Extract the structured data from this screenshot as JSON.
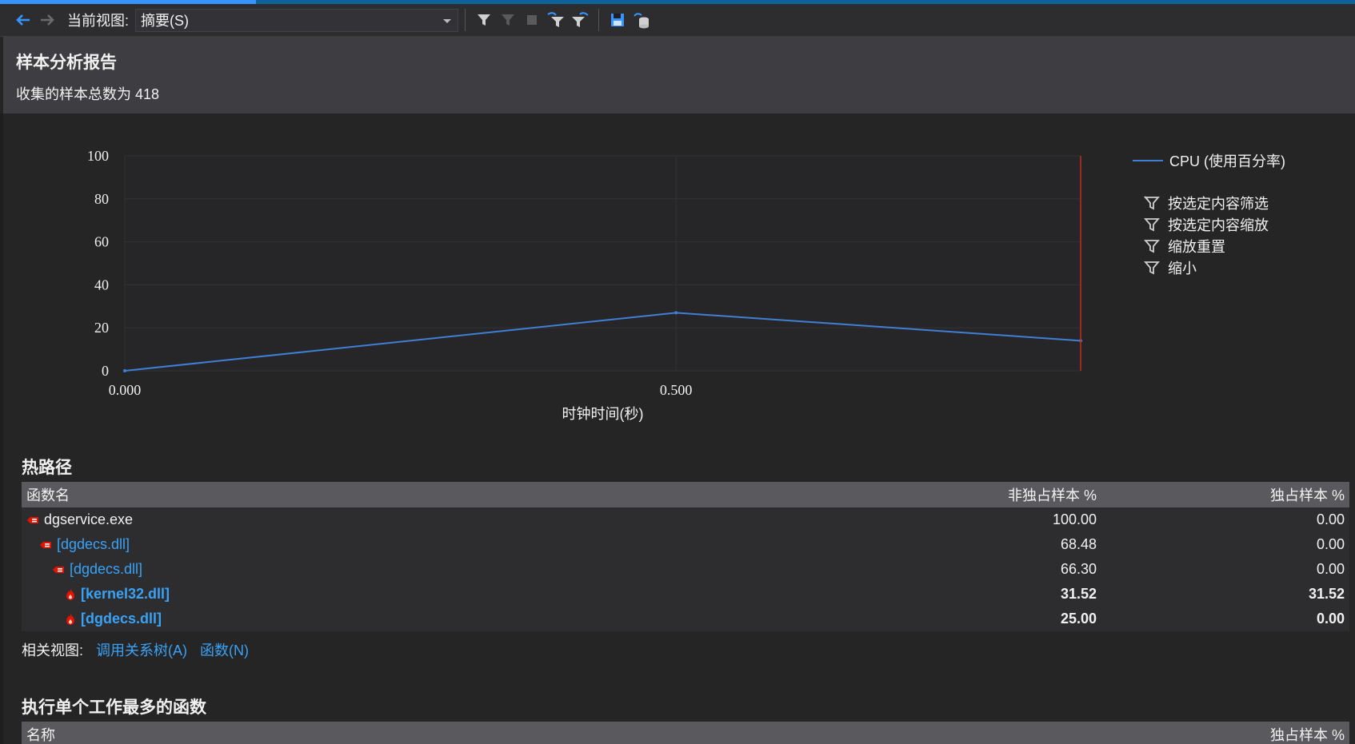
{
  "toolbar": {
    "view_label": "当前视图:",
    "view_value": "摘要(S)"
  },
  "header": {
    "title": "样本分析报告",
    "subtitle": "收集的样本总数为 418"
  },
  "chart_data": {
    "type": "line",
    "x": [
      0.0,
      0.5,
      0.867
    ],
    "series": [
      {
        "name": "CPU (使用百分率)",
        "values": [
          0,
          27,
          14
        ]
      }
    ],
    "xlabel": "时钟时间(秒)",
    "ylabel": "",
    "ylim": [
      0,
      100
    ],
    "xlim": [
      0.0,
      0.867
    ],
    "yticks": [
      0,
      20,
      40,
      60,
      80,
      100
    ],
    "ytick_labels": [
      "0",
      "20",
      "40",
      "60",
      "80",
      "100"
    ],
    "xticks": [
      0.0,
      0.5
    ],
    "xtick_labels": [
      "0.000",
      "0.500"
    ],
    "grid": true,
    "legend": "right",
    "marker_x": 0.867,
    "colors": {
      "series": "#3f7fd6",
      "marker": "#c42b1c",
      "grid": "#333336"
    }
  },
  "chart_legend_actions": [
    {
      "label": "按选定内容筛选",
      "icon": "filter-selection-icon"
    },
    {
      "label": "按选定内容缩放",
      "icon": "filter-zoom-icon"
    },
    {
      "label": "缩放重置",
      "icon": "filter-reset-icon"
    },
    {
      "label": "缩小",
      "icon": "filter-zoomout-icon"
    }
  ],
  "hot_path": {
    "title": "热路径",
    "columns": [
      "函数名",
      "非独占样本 %",
      "独占样本 %"
    ],
    "rows": [
      {
        "name": "dgservice.exe",
        "inclusive": "100.00",
        "exclusive": "0.00",
        "indent": 0,
        "link": false,
        "bold": false,
        "icon": "hot-path-icon"
      },
      {
        "name": "[dgdecs.dll]",
        "inclusive": "68.48",
        "exclusive": "0.00",
        "indent": 1,
        "link": true,
        "bold": false,
        "icon": "hot-path-icon"
      },
      {
        "name": "[dgdecs.dll]",
        "inclusive": "66.30",
        "exclusive": "0.00",
        "indent": 2,
        "link": true,
        "bold": false,
        "icon": "hot-path-icon"
      },
      {
        "name": "[kernel32.dll]",
        "inclusive": "31.52",
        "exclusive": "31.52",
        "indent": 3,
        "link": true,
        "bold": true,
        "icon": "flame-icon"
      },
      {
        "name": "[dgdecs.dll]",
        "inclusive": "25.00",
        "exclusive": "0.00",
        "indent": 3,
        "link": true,
        "bold": true,
        "icon": "flame-icon"
      }
    ],
    "related_label": "相关视图:",
    "related_links": [
      "调用关系树(A)",
      "函数(N)"
    ]
  },
  "top_functions": {
    "title": "执行单个工作最多的函数",
    "columns": [
      "名称",
      "独占样本 %"
    ]
  }
}
